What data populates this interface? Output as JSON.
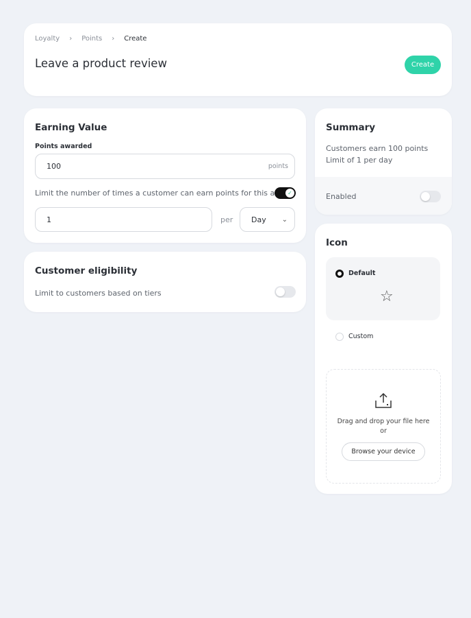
{
  "breadcrumb": [
    "Loyalty",
    "Points",
    "Create"
  ],
  "header": {
    "title": "Leave a product review",
    "create_label": "Create"
  },
  "earning": {
    "title": "Earning Value",
    "points_label": "Points awarded",
    "points_value": "100",
    "points_suffix": "points",
    "limit_label": "Limit the number of times a customer can earn points for this action",
    "limit_enabled": true,
    "limit_value": "1",
    "per_label": "per",
    "period": "Day"
  },
  "eligibility": {
    "title": "Customer eligibility",
    "tiers_label": "Limit to customers based on tiers",
    "tiers_enabled": false
  },
  "summary": {
    "title": "Summary",
    "line1": "Customers earn 100 points",
    "line2": "Limit of 1 per day",
    "enabled_label": "Enabled",
    "enabled": false
  },
  "icon": {
    "title": "Icon",
    "default_label": "Default",
    "custom_label": "Custom",
    "selected": "Default",
    "drop_text": "Drag and drop your file here",
    "or_text": "or",
    "browse_label": "Browse your device"
  },
  "colors": {
    "accent": "#2fd3a9",
    "background": "#eff2f7"
  }
}
